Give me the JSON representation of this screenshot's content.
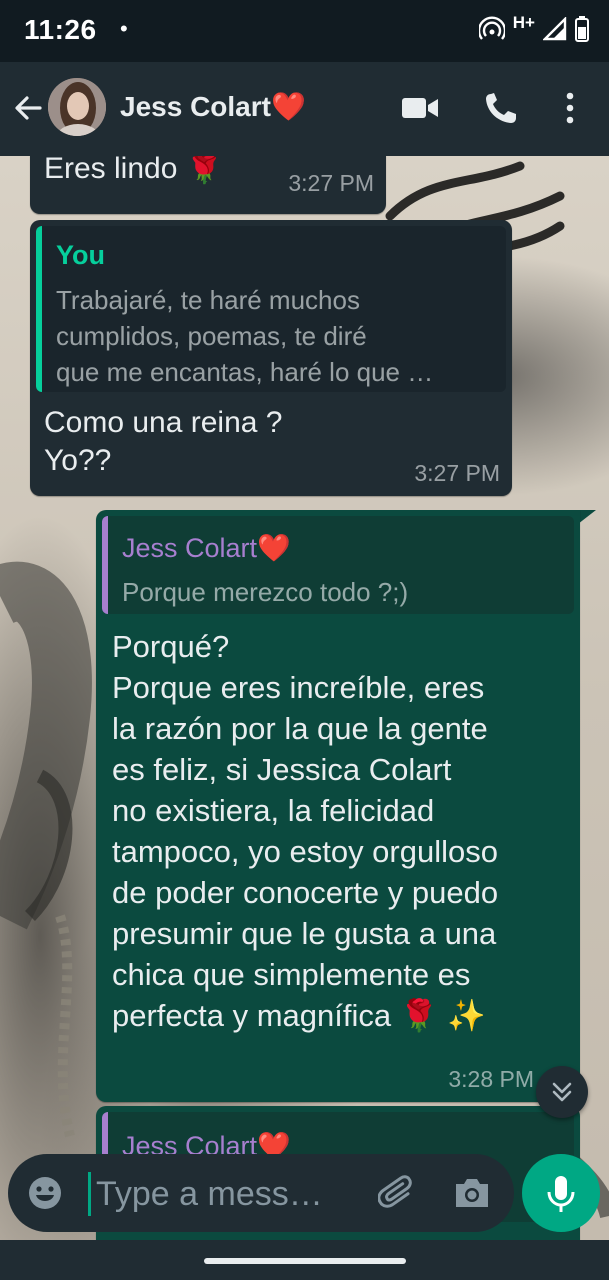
{
  "status_bar": {
    "time": "11:26",
    "dot": "•",
    "network": "H+"
  },
  "header": {
    "contact_name": "Jess Colart❤️"
  },
  "messages": [
    {
      "direction": "incoming",
      "text": "Eres lindo 🌹",
      "time": "3:27 PM"
    },
    {
      "direction": "incoming",
      "quote": {
        "author": "You",
        "text": "Trabajaré, te haré muchos\ncumplidos, poemas, te diré\nque me encantas, haré lo que …"
      },
      "text": "Como una reina ?\nYo??",
      "time": "3:27 PM"
    },
    {
      "direction": "outgoing",
      "quote": {
        "author": "Jess Colart❤️",
        "text": "Porque merezco todo ?;)"
      },
      "text": "Porqué?\nPorque eres increíble, eres\nla razón por la que la gente\nes feliz, si Jessica Colart\nno existiera, la felicidad\ntampoco, yo estoy orgulloso\nde poder conocerte y puedo\npresumir que le gusta a una\nchica que simplemente es\nperfecta y magnífica 🌹 ✨",
      "time": "3:28 PM"
    },
    {
      "direction": "outgoing",
      "quote": {
        "author": "Jess Colart❤️"
      }
    }
  ],
  "composer": {
    "placeholder": "Type a mess…"
  },
  "colors": {
    "accent": "#00a884",
    "you_quote": "#06cf9c",
    "contact_quote": "#a77fcf"
  }
}
